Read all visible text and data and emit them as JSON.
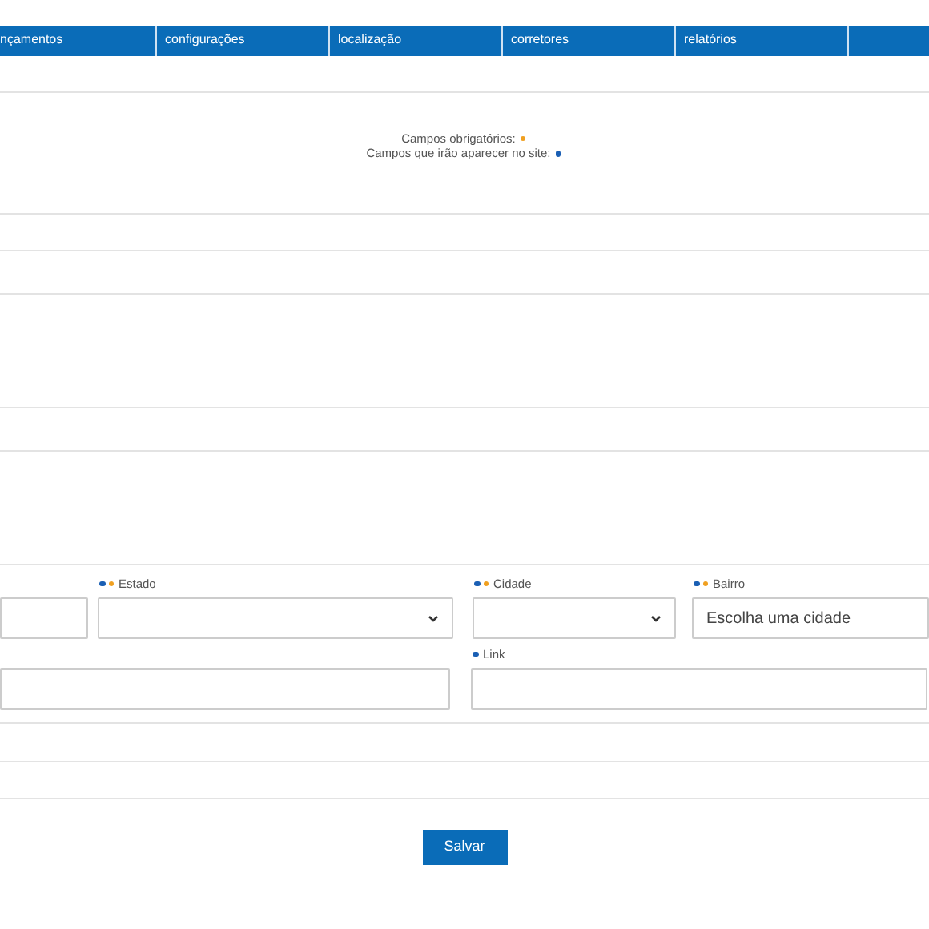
{
  "nav": {
    "tabs": [
      {
        "label": "nçamentos"
      },
      {
        "label": "configurações"
      },
      {
        "label": "localização"
      },
      {
        "label": "corretores"
      },
      {
        "label": "relatórios"
      }
    ]
  },
  "legend": [
    {
      "text": "Campos obrigatórios:",
      "color": "#f0a020"
    },
    {
      "text": "Campos que irão aparecer no site:",
      "color": "#1a5fb4"
    }
  ],
  "field_rows": [
    {
      "fields": [
        {
          "kind": "input"
        },
        {
          "kind": "select",
          "label": "Estado",
          "markers": [
            {
              "color": "#1a5fb4"
            },
            {
              "color": "#f0a020"
            }
          ]
        },
        {
          "kind": "select",
          "label": "Cidade",
          "markers": [
            {
              "color": "#1a5fb4"
            },
            {
              "color": "#f0a020"
            }
          ]
        },
        {
          "kind": "input",
          "label": "Bairro",
          "markers": [
            {
              "color": "#1a5fb4"
            },
            {
              "color": "#f0a020"
            }
          ],
          "value": "Escolha uma cidade"
        }
      ]
    },
    {
      "fields": [
        {
          "kind": "input"
        },
        {
          "kind": "input",
          "label": "Link",
          "markers": [
            {
              "color": "#1a5fb4"
            }
          ]
        }
      ]
    }
  ],
  "save_button": "Salvar"
}
